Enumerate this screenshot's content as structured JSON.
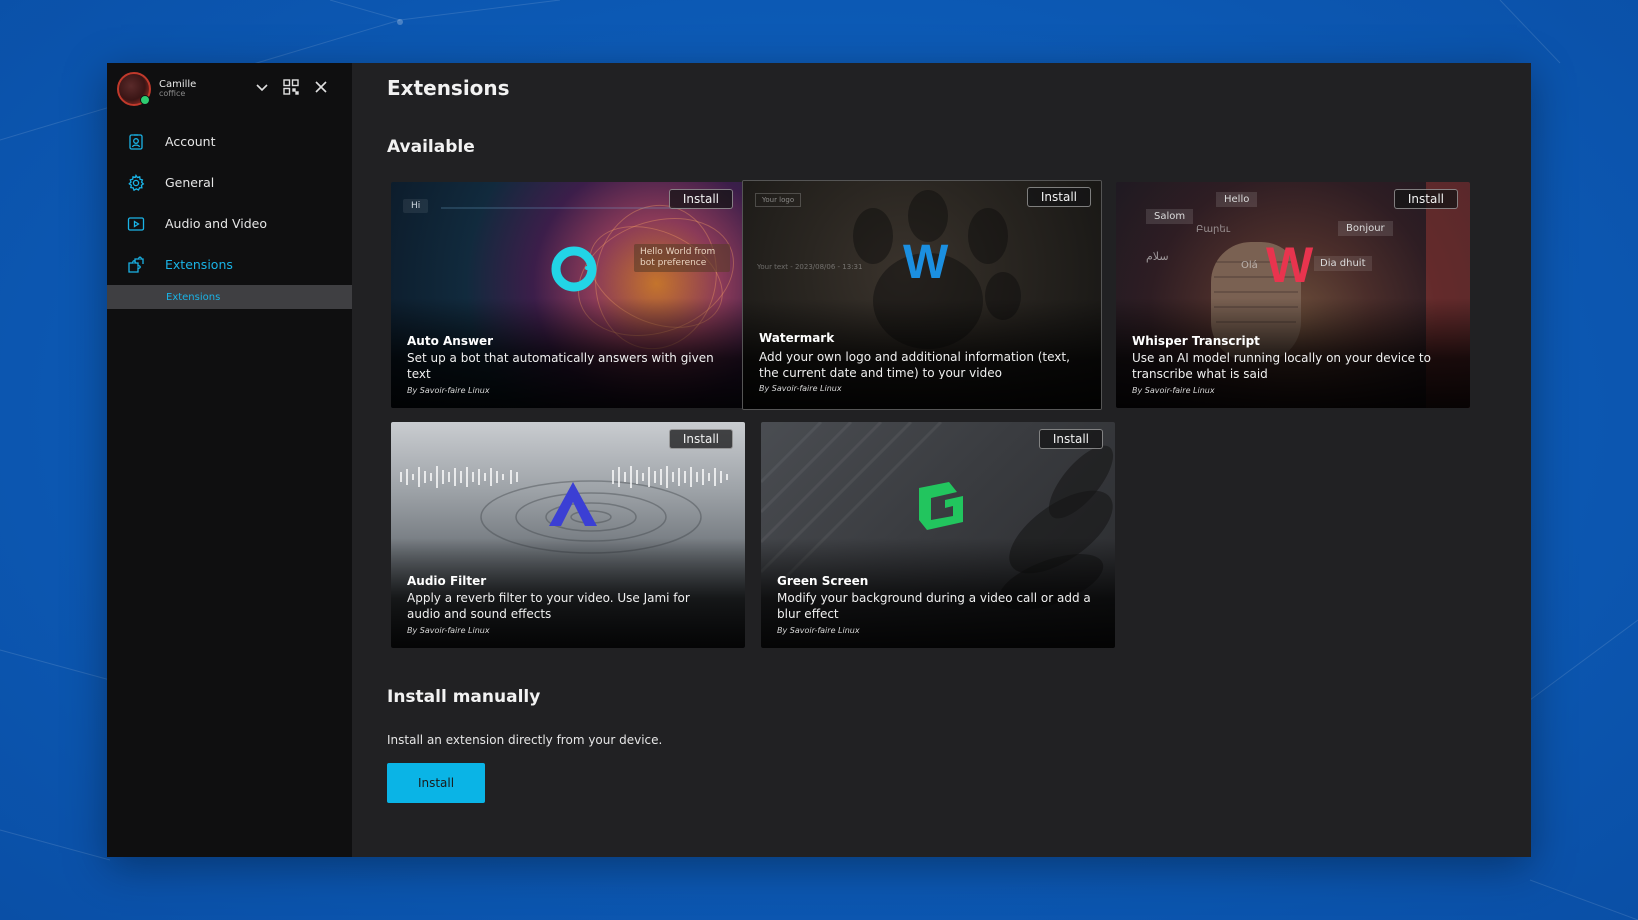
{
  "account": {
    "name": "Camille",
    "subtitle": "coffice"
  },
  "header_icons": [
    "chevron-down-icon",
    "qr-code-icon",
    "close-icon"
  ],
  "sidebar": {
    "items": [
      {
        "label": "Account",
        "icon": "account-badge-icon"
      },
      {
        "label": "General",
        "icon": "gear-icon"
      },
      {
        "label": "Audio and Video",
        "icon": "video-play-icon"
      },
      {
        "label": "Extensions",
        "icon": "puzzle-icon"
      }
    ],
    "sub_item": "Extensions"
  },
  "main": {
    "title": "Extensions",
    "available_title": "Available",
    "cards": [
      {
        "name": "Auto Answer",
        "desc": "Set up a bot that automatically answers with given text",
        "author": "By Savoir-faire Linux",
        "install": "Install",
        "overlay_hi": "Hi",
        "overlay_bubble": "Hello World from bot preference"
      },
      {
        "name": "Watermark",
        "desc": "Add your own logo and additional information (text, the current date and time) to your video",
        "author": "By Savoir-faire Linux",
        "install": "Install",
        "overlay_logo": "Your logo",
        "overlay_text": "Your text - 2023/08/06 - 13:31"
      },
      {
        "name": "Whisper Transcript",
        "desc": "Use an AI model running locally on your device to transcribe what is said",
        "author": "By Savoir-faire Linux",
        "install": "Install",
        "words": [
          "Salom",
          "Hello",
          "Bonjour",
          "Բարեւ",
          "سلام",
          "Olá",
          "Dia dhuit"
        ]
      },
      {
        "name": "Audio Filter",
        "desc": "Apply a reverb filter to your video. Use Jami for audio and sound effects",
        "author": "By Savoir-faire Linux",
        "install": "Install"
      },
      {
        "name": "Green Screen",
        "desc": "Modify your background during a video call or add a blur effect",
        "author": "By Savoir-faire Linux",
        "install": "Install"
      }
    ],
    "manual_title": "Install manually",
    "manual_text": "Install an extension directly from your device.",
    "manual_button": "Install"
  },
  "colors": {
    "accent": "#0ab4e6",
    "sidebar_bg": "#0f0f10",
    "main_bg": "#212123",
    "desktop": "#0d5cb8"
  }
}
